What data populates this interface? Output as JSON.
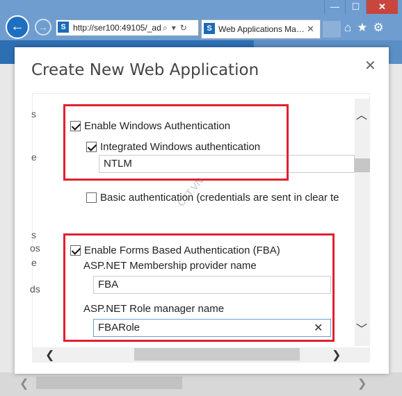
{
  "browser": {
    "address": "http://ser100:49105/_ad",
    "address_tools": [
      "⌕",
      "▾",
      "↻"
    ],
    "tab_title": "Web Applications Ma…",
    "window_buttons": [
      "—",
      "☐",
      "✕"
    ]
  },
  "dialog": {
    "title": "Create New Web Application",
    "close": "✕",
    "left_fragments": [
      "s",
      "e",
      "s",
      "os",
      "e",
      "ds"
    ]
  },
  "windows_auth": {
    "enable_label": "Enable Windows Authentication",
    "enable_checked": true,
    "integrated_label": "Integrated Windows authentication",
    "integrated_checked": true,
    "integrated_value": "NTLM",
    "basic_label": "Basic authentication (credentials are sent in clear te",
    "basic_checked": false
  },
  "fba": {
    "enable_label": "Enable Forms Based Authentication (FBA)",
    "enable_checked": true,
    "membership_label": "ASP.NET Membership provider name",
    "membership_value": "FBA",
    "role_label": "ASP.NET Role manager name",
    "role_value": "FBARole"
  },
  "watermark": "CTT.VN",
  "colors": {
    "highlight_box": "#e0202e",
    "chrome": "#6f9dd0",
    "accent": "#1e6fc1"
  }
}
